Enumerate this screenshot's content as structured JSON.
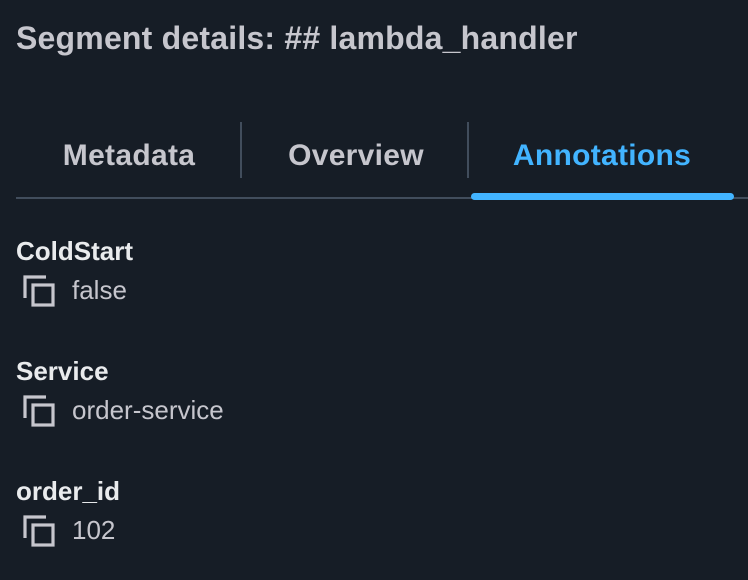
{
  "panel": {
    "title": "Segment details: ## lambda_handler"
  },
  "tabs": [
    {
      "label": "Metadata",
      "active": false
    },
    {
      "label": "Overview",
      "active": false
    },
    {
      "label": "Annotations",
      "active": true
    }
  ],
  "annotations": [
    {
      "key": "ColdStart",
      "value": "false",
      "icon": "copy-icon"
    },
    {
      "key": "Service",
      "value": "order-service",
      "icon": "copy-icon"
    },
    {
      "key": "order_id",
      "value": "102",
      "icon": "copy-icon"
    }
  ],
  "colors": {
    "background": "#161d26",
    "active_tab": "#42b4ff",
    "text": "#e9ebed",
    "muted_text": "#c6c6cd",
    "divider": "#414d5c"
  }
}
